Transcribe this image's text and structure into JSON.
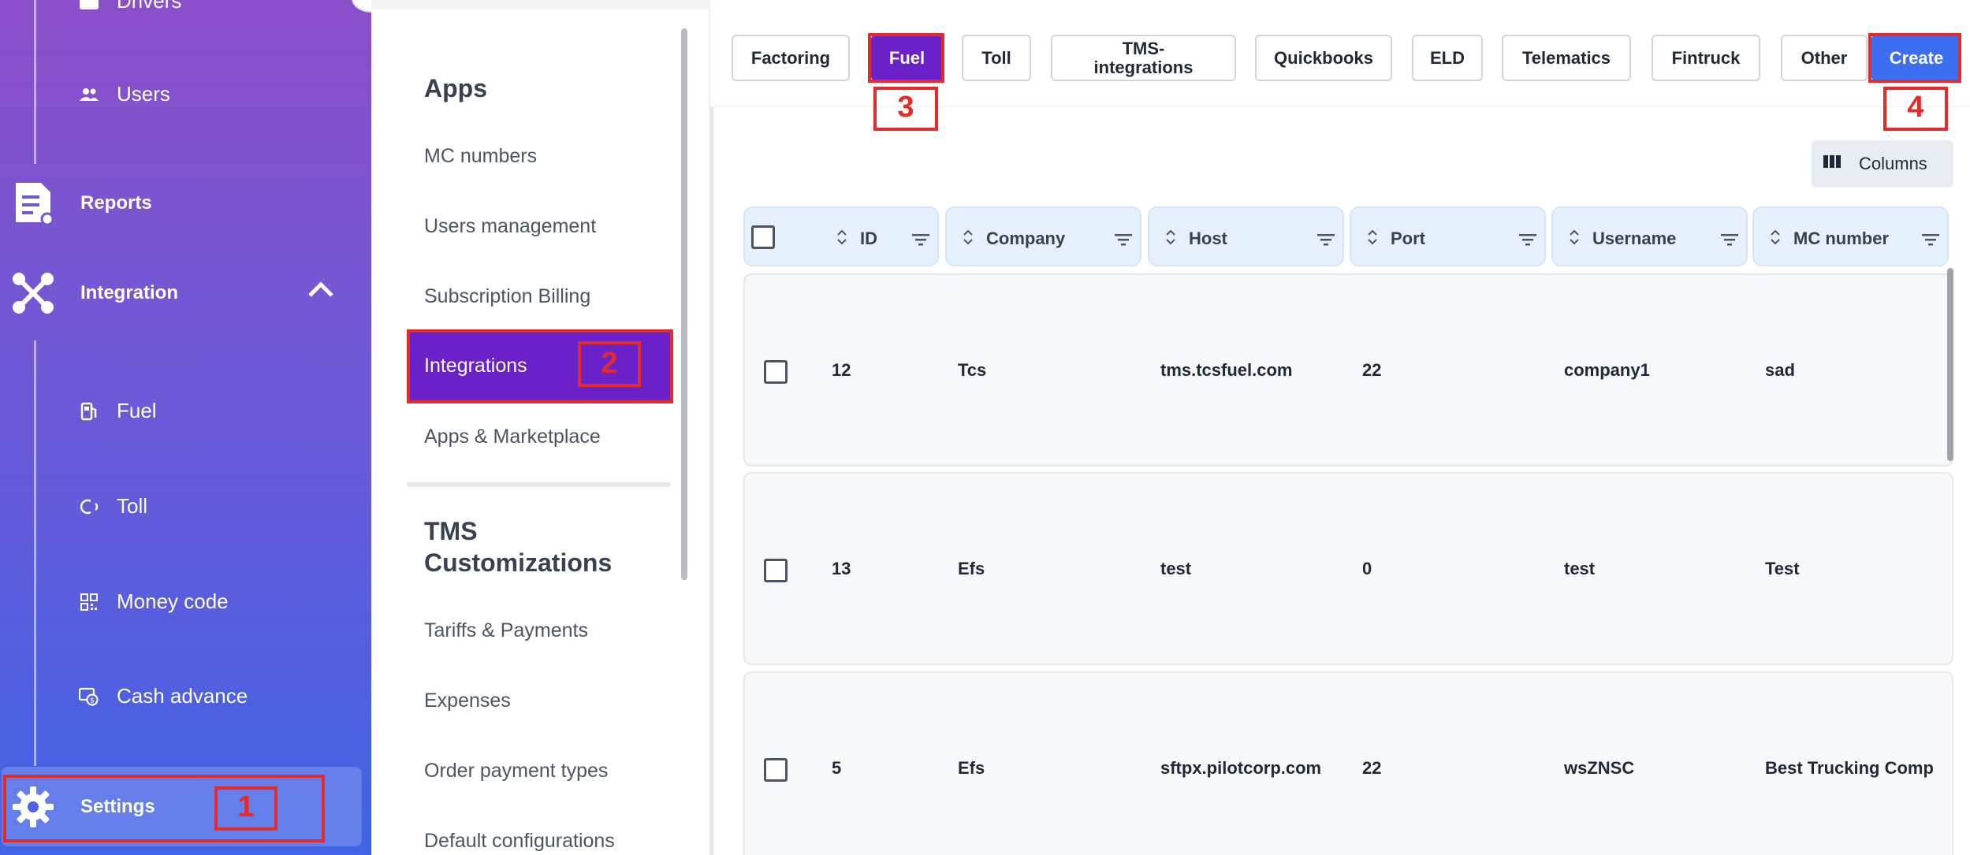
{
  "sidebar": {
    "items": [
      {
        "label": "Drivers",
        "icon": "id-card-icon"
      },
      {
        "label": "Users",
        "icon": "users-icon"
      },
      {
        "label": "Reports",
        "icon": "report-icon"
      },
      {
        "label": "Integration",
        "icon": "integration-icon"
      },
      {
        "label": "Fuel",
        "icon": "fuel-icon"
      },
      {
        "label": "Toll",
        "icon": "toll-icon"
      },
      {
        "label": "Money code",
        "icon": "qr-code-icon"
      },
      {
        "label": "Cash advance",
        "icon": "cash-advance-icon"
      },
      {
        "label": "Settings",
        "icon": "gear-icon"
      }
    ]
  },
  "menu": {
    "section_apps": "Apps",
    "items": [
      "MC numbers",
      "Users management",
      "Subscription Billing",
      "Integrations",
      "Apps & Marketplace"
    ],
    "section_tms": "TMS Customizations",
    "tms_items": [
      "Tariffs & Payments",
      "Expenses",
      "Order payment types",
      "Default configurations"
    ]
  },
  "tabs": [
    "Factoring",
    "Fuel",
    "Toll",
    "TMS-integrations",
    "Quickbooks",
    "ELD",
    "Telematics",
    "Fintruck",
    "Other"
  ],
  "create_label": "Create",
  "columns_label": "Columns",
  "table": {
    "headers": [
      "ID",
      "Company",
      "Host",
      "Port",
      "Username",
      "MC number"
    ],
    "rows": [
      [
        "12",
        "Tcs",
        "tms.tcsfuel.com",
        "22",
        "company1",
        "sad"
      ],
      [
        "13",
        "Efs",
        "test",
        "0",
        "test",
        "Test"
      ],
      [
        "5",
        "Efs",
        "sftpx.pilotcorp.com",
        "22",
        "wsZNSC",
        "Best Trucking Comp"
      ]
    ]
  },
  "annotations": [
    "1",
    "2",
    "3",
    "4"
  ],
  "colors": {
    "accent_purple": "#6b21c8",
    "create_blue": "#3b6ef0",
    "annotation_red": "#e42b2b"
  }
}
